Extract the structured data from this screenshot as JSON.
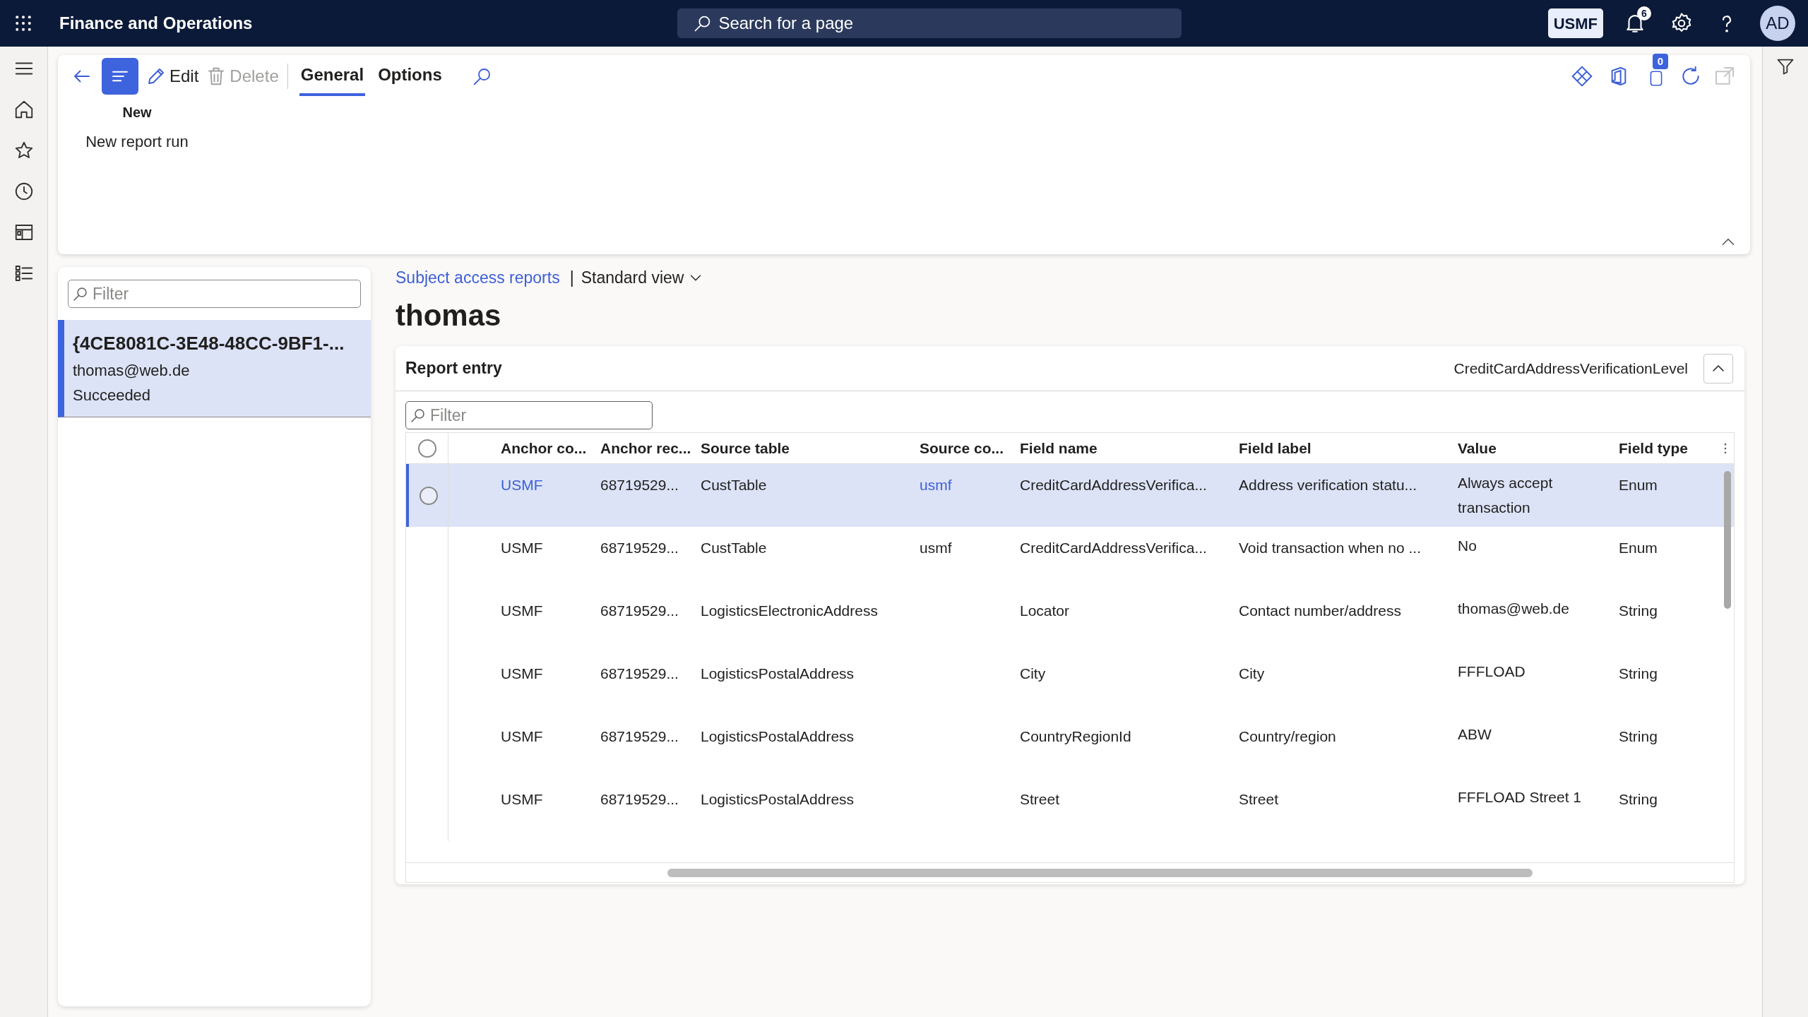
{
  "top_bar": {
    "app_title": "Finance and Operations",
    "search": {
      "placeholder": "Search for a page"
    },
    "company": "USMF",
    "notification_count": "6",
    "avatar": "AD"
  },
  "action_pane": {
    "buttons": [
      {
        "label": "Edit",
        "kind": "edit",
        "disabled": false
      },
      {
        "label": "Delete",
        "kind": "delete",
        "disabled": true
      }
    ],
    "tabs": [
      {
        "label": "General",
        "selected": true
      },
      {
        "label": "Options",
        "selected": false
      }
    ],
    "attachment_count": "0",
    "group": {
      "title": "New",
      "items": [
        "New report run"
      ]
    }
  },
  "list_panel": {
    "filter": {
      "placeholder": "Filter"
    },
    "items": [
      {
        "title": "{4CE8081C-3E48-48CC-9BF1-...",
        "email": "thomas@web.de",
        "status": "Succeeded",
        "selected": true
      }
    ]
  },
  "breadcrumb": {
    "link": "Subject access reports",
    "separator": "|",
    "view": "Standard view"
  },
  "page_title": "thomas",
  "report_entry": {
    "title": "Report entry",
    "select_all": false,
    "summary": "CreditCardAddressVerificationLevel",
    "filter": {
      "placeholder": "Filter"
    },
    "columns": [
      "Anchor co...",
      "Anchor rec...",
      "Source table",
      "Source co...",
      "Field name",
      "Field label",
      "Value",
      "Field type"
    ],
    "rows": [
      {
        "selected": true,
        "cells": [
          "USMF",
          "68719529...",
          "CustTable",
          "usmf",
          "CreditCardAddressVerifica...",
          "Address verification statu...",
          "Always accept transaction",
          "Enum"
        ]
      },
      {
        "selected": false,
        "cells": [
          "USMF",
          "68719529...",
          "CustTable",
          "usmf",
          "CreditCardAddressVerifica...",
          "Void transaction when no ...",
          "No",
          "Enum"
        ]
      },
      {
        "selected": false,
        "cells": [
          "USMF",
          "68719529...",
          "LogisticsElectronicAddress",
          null,
          "Locator",
          "Contact number/address",
          "thomas@web.de",
          "String"
        ]
      },
      {
        "selected": false,
        "cells": [
          "USMF",
          "68719529...",
          "LogisticsPostalAddress",
          null,
          "City",
          "City",
          "FFFLOAD",
          "String"
        ]
      },
      {
        "selected": false,
        "cells": [
          "USMF",
          "68719529...",
          "LogisticsPostalAddress",
          null,
          "CountryRegionId",
          "Country/region",
          "ABW",
          "String"
        ]
      },
      {
        "selected": false,
        "cells": [
          "USMF",
          "68719529...",
          "LogisticsPostalAddress",
          null,
          "Street",
          "Street",
          "FFFLOAD Street 1",
          "String"
        ]
      }
    ]
  }
}
